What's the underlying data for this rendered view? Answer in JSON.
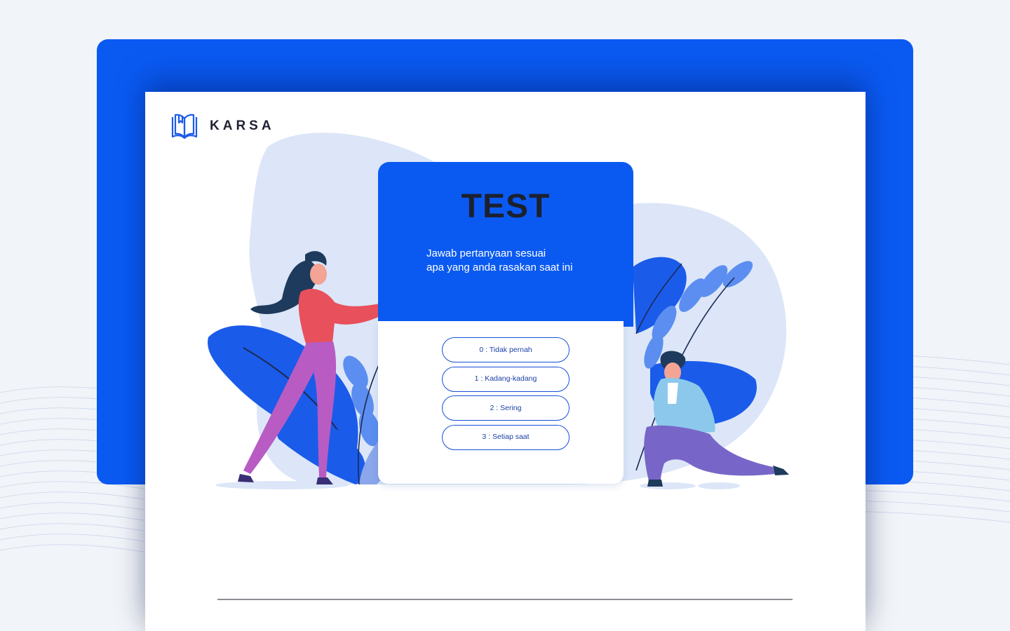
{
  "brand": {
    "name": "KARSA",
    "icon": "open-book-icon"
  },
  "test_card": {
    "title": "TEST",
    "subtitle_lines": [
      "Jawab pertanyaan sesuai",
      "apa yang anda rasakan saat ini"
    ]
  },
  "options": [
    {
      "label": "0 : Tidak pernah"
    },
    {
      "label": "1 : Kadang-kadang"
    },
    {
      "label": "2 : Sering"
    },
    {
      "label": "3 : Setiap saat"
    }
  ],
  "colors": {
    "accent": "#0a5af2",
    "page_background": "#f1f4f8",
    "blob": "#dce6f8",
    "leaf_dark": "#1a5bea",
    "leaf_light": "#5b8ef0",
    "woman_top": "#e8505b",
    "woman_pants": "#b85cc4",
    "woman_hair": "#1e3a5c",
    "man_jacket": "#8cc8ec",
    "man_pants": "#7766c8"
  }
}
